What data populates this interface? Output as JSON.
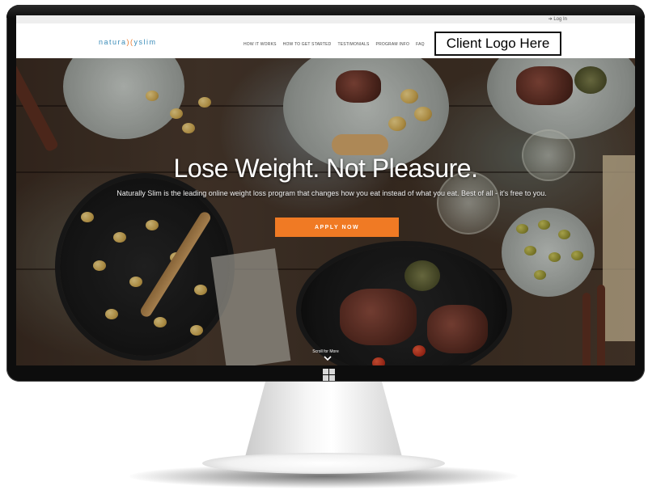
{
  "website": {
    "login_label": "Log In",
    "brand_left": "natura",
    "brand_mid": ")(",
    "brand_right": "yslim",
    "nav_items": [
      {
        "label": "HOW IT WORKS"
      },
      {
        "label": "HOW TO GET STARTED"
      },
      {
        "label": "TESTIMONIALS"
      },
      {
        "label": "PROGRAM INFO"
      },
      {
        "label": "FAQ"
      }
    ],
    "client_logo_label": "Client Logo Here",
    "hero": {
      "headline": "Lose Weight. Not Pleasure.",
      "subtext": "Naturally Slim is the leading online weight loss program that changes how you eat instead of what you eat. Best of all - it's free to you.",
      "cta_label": "APPLY NOW",
      "scroll_label": "Scroll for More"
    }
  },
  "colors": {
    "accent_orange": "#f07a24",
    "brand_blue": "#3a8cb8",
    "topbar": "#eeeeee",
    "monitor_frame": "#0d0d0d"
  },
  "icons": {
    "login": "login-arrow-icon",
    "scroll": "chevron-down-icon",
    "monitor_logo": "windows-logo-icon"
  }
}
